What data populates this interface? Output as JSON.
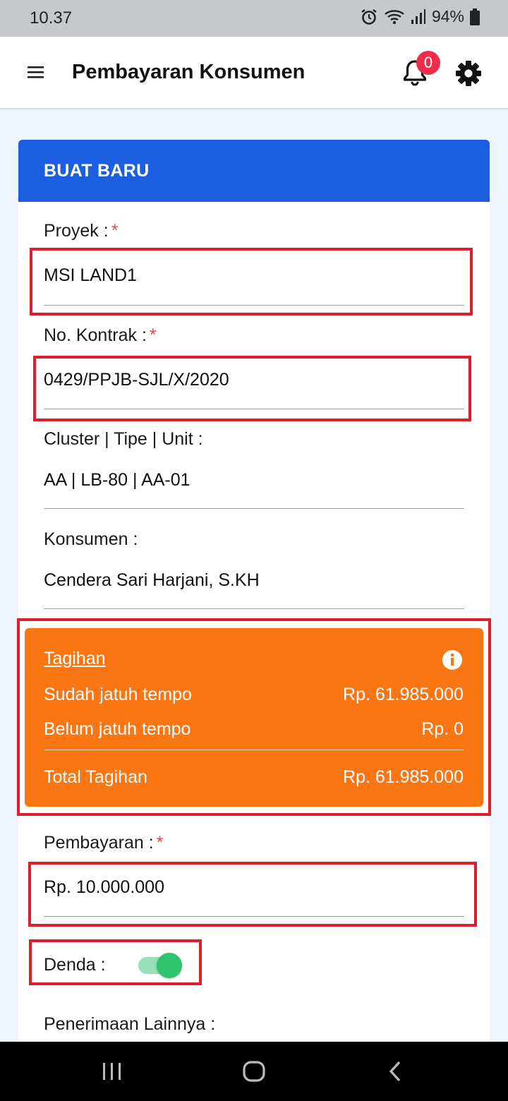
{
  "status_bar": {
    "time": "10.37",
    "battery": "94%",
    "icons": [
      "alarm-icon",
      "wifi-icon",
      "signal-icon",
      "battery-icon"
    ]
  },
  "app_bar": {
    "title": "Pembayaran Konsumen",
    "notification_count": "0",
    "icons": [
      "menu-icon",
      "bell-icon",
      "gear-icon"
    ]
  },
  "card": {
    "header": "BUAT BARU",
    "required_mark": "*",
    "proyek": {
      "label": "Proyek :",
      "value": "MSI LAND1"
    },
    "kontrak": {
      "label": "No. Kontrak :",
      "value": "0429/PPJB-SJL/X/2020"
    },
    "unit": {
      "label": "Cluster | Tipe | Unit :",
      "value": "AA | LB-80 | AA-01"
    },
    "konsumen": {
      "label": "Konsumen :",
      "value": "Cendera Sari Harjani, S.KH"
    },
    "tagihan": {
      "title": "Tagihan",
      "rows": [
        {
          "label": "Sudah jatuh tempo",
          "amount": "Rp. 61.985.000"
        },
        {
          "label": "Belum jatuh tempo",
          "amount": "Rp. 0"
        }
      ],
      "total_label": "Total Tagihan",
      "total_amount": "Rp. 61.985.000"
    },
    "pembayaran": {
      "label": "Pembayaran :",
      "value": "Rp. 10.000.000"
    },
    "denda": {
      "label": "Denda :",
      "enabled": true
    },
    "penerimaan": {
      "label": "Penerimaan Lainnya :"
    }
  },
  "colors": {
    "header_blue": "#1b5fe0",
    "tagihan_orange": "#fa7612",
    "highlight_red": "#dc1e2e",
    "toggle_green": "#2fc36b",
    "badge_red": "#ee2d4a"
  }
}
